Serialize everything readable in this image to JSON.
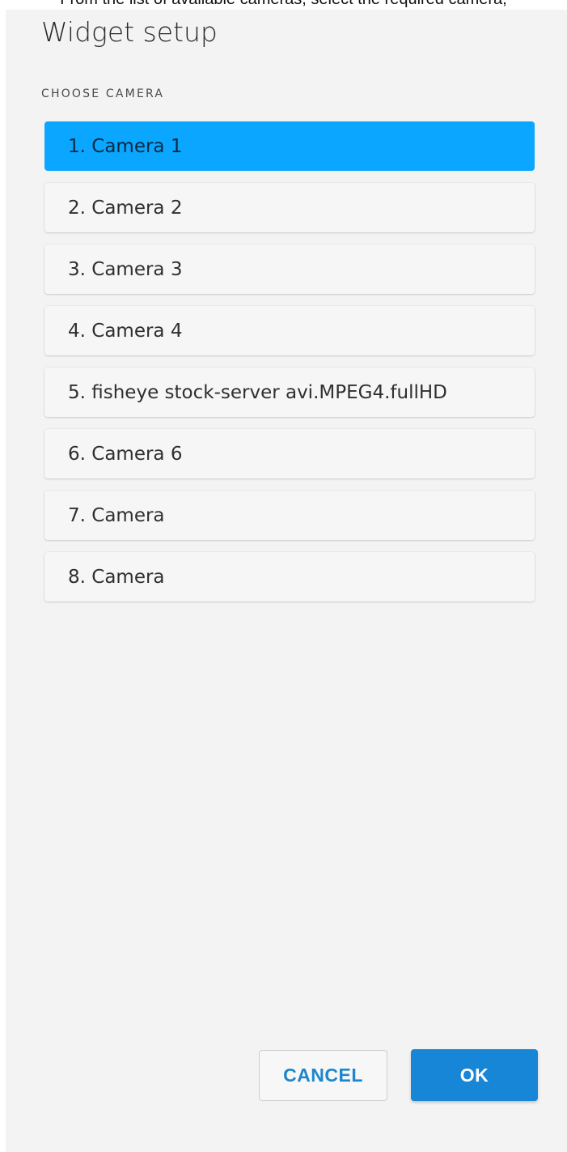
{
  "caption": "From the list of available cameras, select the required camera,",
  "dialog": {
    "title": "Widget setup",
    "section_label": "CHOOSE CAMERA",
    "cameras": [
      "1. Camera 1",
      "2. Camera 2",
      "3. Camera 3",
      "4. Camera 4",
      "5. fisheye stock-server avi.MPEG4.fullHD",
      "6. Camera 6",
      "7. Camera",
      "8. Camera"
    ],
    "selected_index": 0,
    "cancel_label": "CANCEL",
    "ok_label": "OK"
  },
  "colors": {
    "selected_bg": "#0aa6ff",
    "primary_button": "#1886d6",
    "cancel_text": "#1d86cc",
    "dialog_bg": "#f3f3f3"
  }
}
